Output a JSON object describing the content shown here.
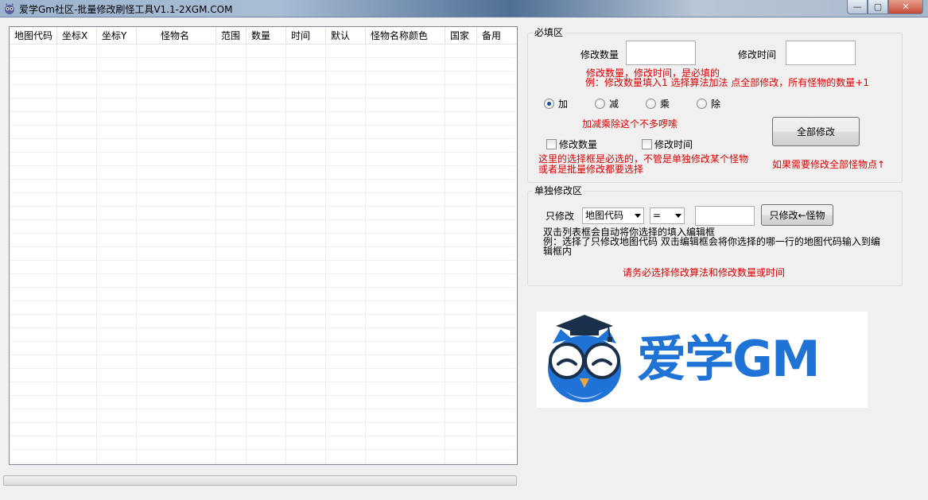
{
  "window": {
    "title": "爱学Gm社区-批量修改刷怪工具V1.1-2XGM.COM",
    "minimize_glyph": "—",
    "maximize_glyph": "▢",
    "close_glyph": "✕"
  },
  "list": {
    "columns": [
      "地图代码",
      "坐标X",
      "坐标Y",
      "怪物名",
      "范围",
      "数量",
      "时间",
      "默认",
      "怪物名称颜色",
      "国家",
      "备用"
    ]
  },
  "required_section": {
    "title": "必填区",
    "modify_count_label": "修改数量",
    "modify_count_value": "",
    "modify_time_label": "修改时间",
    "modify_time_value": "",
    "note_line1": "修改数量，修改时间，是必填的",
    "note_line2": "例：修改数量填入1 选择算法加法 点全部修改，所有怪物的数量+1",
    "ops": [
      {
        "label": "加",
        "selected": true
      },
      {
        "label": "减",
        "selected": false
      },
      {
        "label": "乘",
        "selected": false
      },
      {
        "label": "除",
        "selected": false
      }
    ],
    "ops_note": "加减乘除这个不多啰嗦",
    "check_count_label": "修改数量",
    "check_time_label": "修改时间",
    "check_note_line1": "这里的选择框是必选的，不管是单独修改某个怪物",
    "check_note_line2": "或者是批量修改都要选择",
    "modify_all_button": "全部修改",
    "modify_all_hint": "如果需要修改全部怪物点↑"
  },
  "single_section": {
    "title": "单独修改区",
    "only_modify_label": "只修改",
    "field_select": "地图代码",
    "operator_select": "=",
    "value": "",
    "only_modify_button": "只修改←怪物",
    "help_line1": "双击列表框会自动将你选择的填入编辑框",
    "help_line2": "例：选择了只修改地图代码 双击编辑框会将你选择的哪一行的地图代码输入到编",
    "help_line3": "辑框内",
    "warning": "请务必选择修改算法和修改数量或时间"
  },
  "logo": {
    "text": "爱学GM",
    "brand_color": "#1f73d6"
  }
}
